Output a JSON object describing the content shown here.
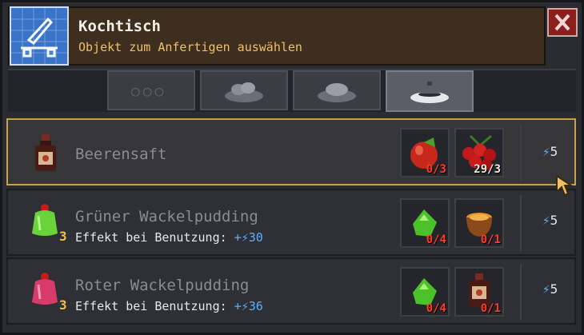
{
  "header": {
    "title": "Kochtisch",
    "subtitle": "Objekt zum Anfertigen auswählen",
    "icon": "blueprint-saw-icon"
  },
  "tabs": [
    {
      "name": "more",
      "label": "○○○",
      "active": false
    },
    {
      "name": "bread",
      "active": false
    },
    {
      "name": "meat",
      "active": false
    },
    {
      "name": "dish",
      "active": true
    }
  ],
  "recipes": [
    {
      "name": "Beerensaft",
      "selected": true,
      "quantity": "",
      "effect_label": "",
      "effect_value": "",
      "ingredients": [
        {
          "icon": "tomato-icon",
          "count": "0/3",
          "enough": false
        },
        {
          "icon": "berries-icon",
          "count": "29/3",
          "enough": true
        }
      ],
      "energy": "5"
    },
    {
      "name": "Grüner Wackelpudding",
      "selected": false,
      "quantity": "3",
      "effect_label": "Effekt bei Benutzung:",
      "effect_value": "+⚡30",
      "ingredients": [
        {
          "icon": "green-gem-icon",
          "count": "0/4",
          "enough": false
        },
        {
          "icon": "honey-bowl-icon",
          "count": "0/1",
          "enough": false
        }
      ],
      "energy": "5"
    },
    {
      "name": "Roter Wackelpudding",
      "selected": false,
      "quantity": "3",
      "effect_label": "Effekt bei Benutzung:",
      "effect_value": "+⚡36",
      "ingredients": [
        {
          "icon": "green-gem-icon",
          "count": "0/4",
          "enough": false
        },
        {
          "icon": "juice-bottle-icon",
          "count": "0/1",
          "enough": false
        }
      ],
      "energy": "5"
    }
  ],
  "colors": {
    "selected_border": "#c9a04a",
    "missing_count": "#ff3a2a",
    "energy_blue": "#5ab0ff",
    "subtitle": "#f0c06a"
  }
}
